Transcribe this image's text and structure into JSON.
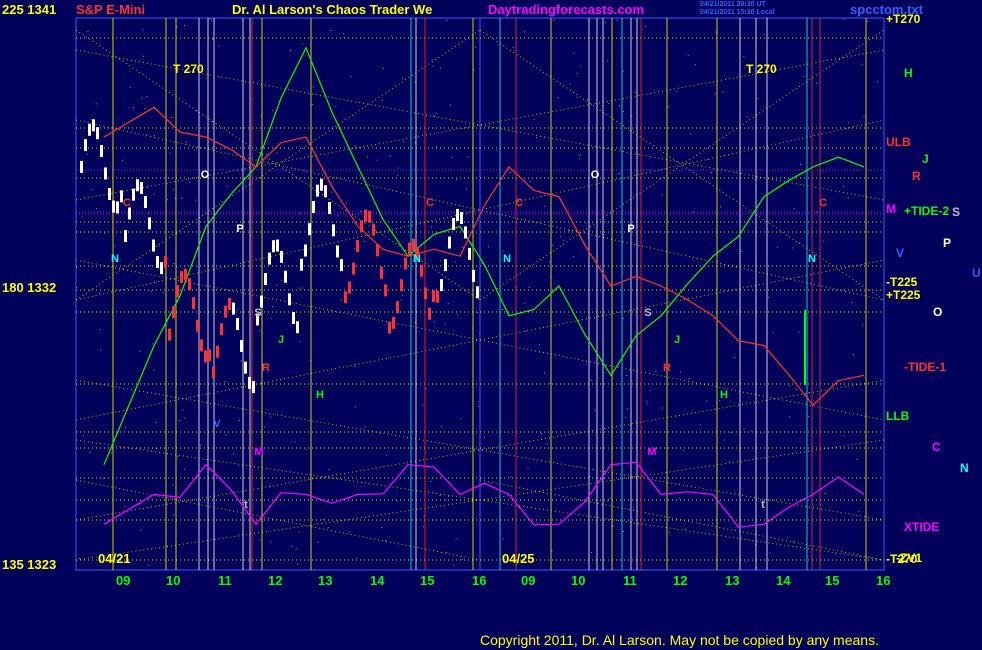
{
  "header": {
    "scale_top_left": "225 1341",
    "instrument": "S&P E-Mini",
    "title": "Dr. Al Larson's Chaos Trader We",
    "site": "Daytradingforecasts.com",
    "stamp_line1": "04/21/2011 20:30 UT",
    "stamp_line2": "04/21/2011 15:30 Local",
    "filename": "spcctom.txt"
  },
  "left_axis": {
    "mid": "180 1332",
    "bottom": "135 1323"
  },
  "date_labels": [
    "04/21",
    "04/25"
  ],
  "x_ticks": [
    "09",
    "10",
    "11",
    "12",
    "13",
    "14",
    "15",
    "16",
    "09",
    "10",
    "11",
    "12",
    "13",
    "14",
    "15",
    "16"
  ],
  "t270_label": "T  270",
  "right_labels": [
    {
      "text": "+T270",
      "color": "#ffff00"
    },
    {
      "text": "H",
      "color": "#00ff00"
    },
    {
      "text": "ULB",
      "color": "#ff3030"
    },
    {
      "text": "J",
      "color": "#00ff00"
    },
    {
      "text": "R",
      "color": "#ff3030"
    },
    {
      "text": "M",
      "color": "#ff00ff"
    },
    {
      "text": "+TIDE-2",
      "color": "#00ff00"
    },
    {
      "text": "S",
      "color": "#c0c0c0"
    },
    {
      "text": "V",
      "color": "#3060ff"
    },
    {
      "text": "P",
      "color": "#ffffff"
    },
    {
      "text": "U",
      "color": "#3060ff"
    },
    {
      "text": "-T225",
      "color": "#ffff00"
    },
    {
      "text": "+T225",
      "color": "#ffff00"
    },
    {
      "text": "O",
      "color": "#ffffff"
    },
    {
      "text": "-TIDE-1",
      "color": "#ff3030"
    },
    {
      "text": "LLB",
      "color": "#00ff00"
    },
    {
      "text": "C",
      "color": "#ff00ff"
    },
    {
      "text": "N",
      "color": "#00ffff"
    },
    {
      "text": "XTIDE",
      "color": "#ff00ff"
    },
    {
      "text": "-T270",
      "color": "#ffff00"
    },
    {
      "text": "-ZV1",
      "color": "#ffff00"
    }
  ],
  "copyright": "Copyright 2011, Dr. Al Larson. May not be copied by any means.",
  "colors": {
    "background": "#00005a",
    "yellow": "#ffff00",
    "green": "#00ff00",
    "red": "#ff3030",
    "magenta": "#ff00ff",
    "cyan": "#00ffff",
    "white": "#ffffff",
    "blue": "#3060ff",
    "gray": "#c0c0c0"
  },
  "chart_data": {
    "type": "line",
    "title": "S&P E-Mini",
    "y_price_labels": [
      1341,
      1332,
      1323
    ],
    "y_angle_labels": [
      225,
      180,
      135
    ],
    "x_dates": [
      "04/21",
      "04/25"
    ],
    "x_hours": [
      "09",
      "10",
      "11",
      "12",
      "13",
      "14",
      "15",
      "16",
      "09",
      "10",
      "11",
      "12",
      "13",
      "14",
      "15",
      "16"
    ],
    "series": [
      {
        "name": "+TIDE-2",
        "color": "#00ff00",
        "values": [
          1326,
          1330,
          1334,
          1336,
          1340,
          1336,
          1333,
          1334,
          1331,
          1332,
          1329,
          1331,
          1333,
          1335,
          1336,
          1336
        ]
      },
      {
        "name": "-TIDE-1",
        "color": "#ff3030",
        "values": [
          1337,
          1338,
          1337,
          1336,
          1337,
          1334,
          1333,
          1333,
          1336,
          1335,
          1332,
          1332,
          1331,
          1330,
          1328,
          1329
        ]
      },
      {
        "name": "XTIDE",
        "color": "#ff00ff",
        "values": [
          1324,
          1325,
          1326,
          1324,
          1325,
          1325,
          1326,
          1325,
          1325,
          1324,
          1326,
          1325,
          1325,
          1324,
          1325,
          1325
        ]
      }
    ],
    "price_bars_close": [
      1336,
      1334,
      1331,
      1330,
      1332,
      1334,
      1333,
      1332,
      1333
    ]
  }
}
